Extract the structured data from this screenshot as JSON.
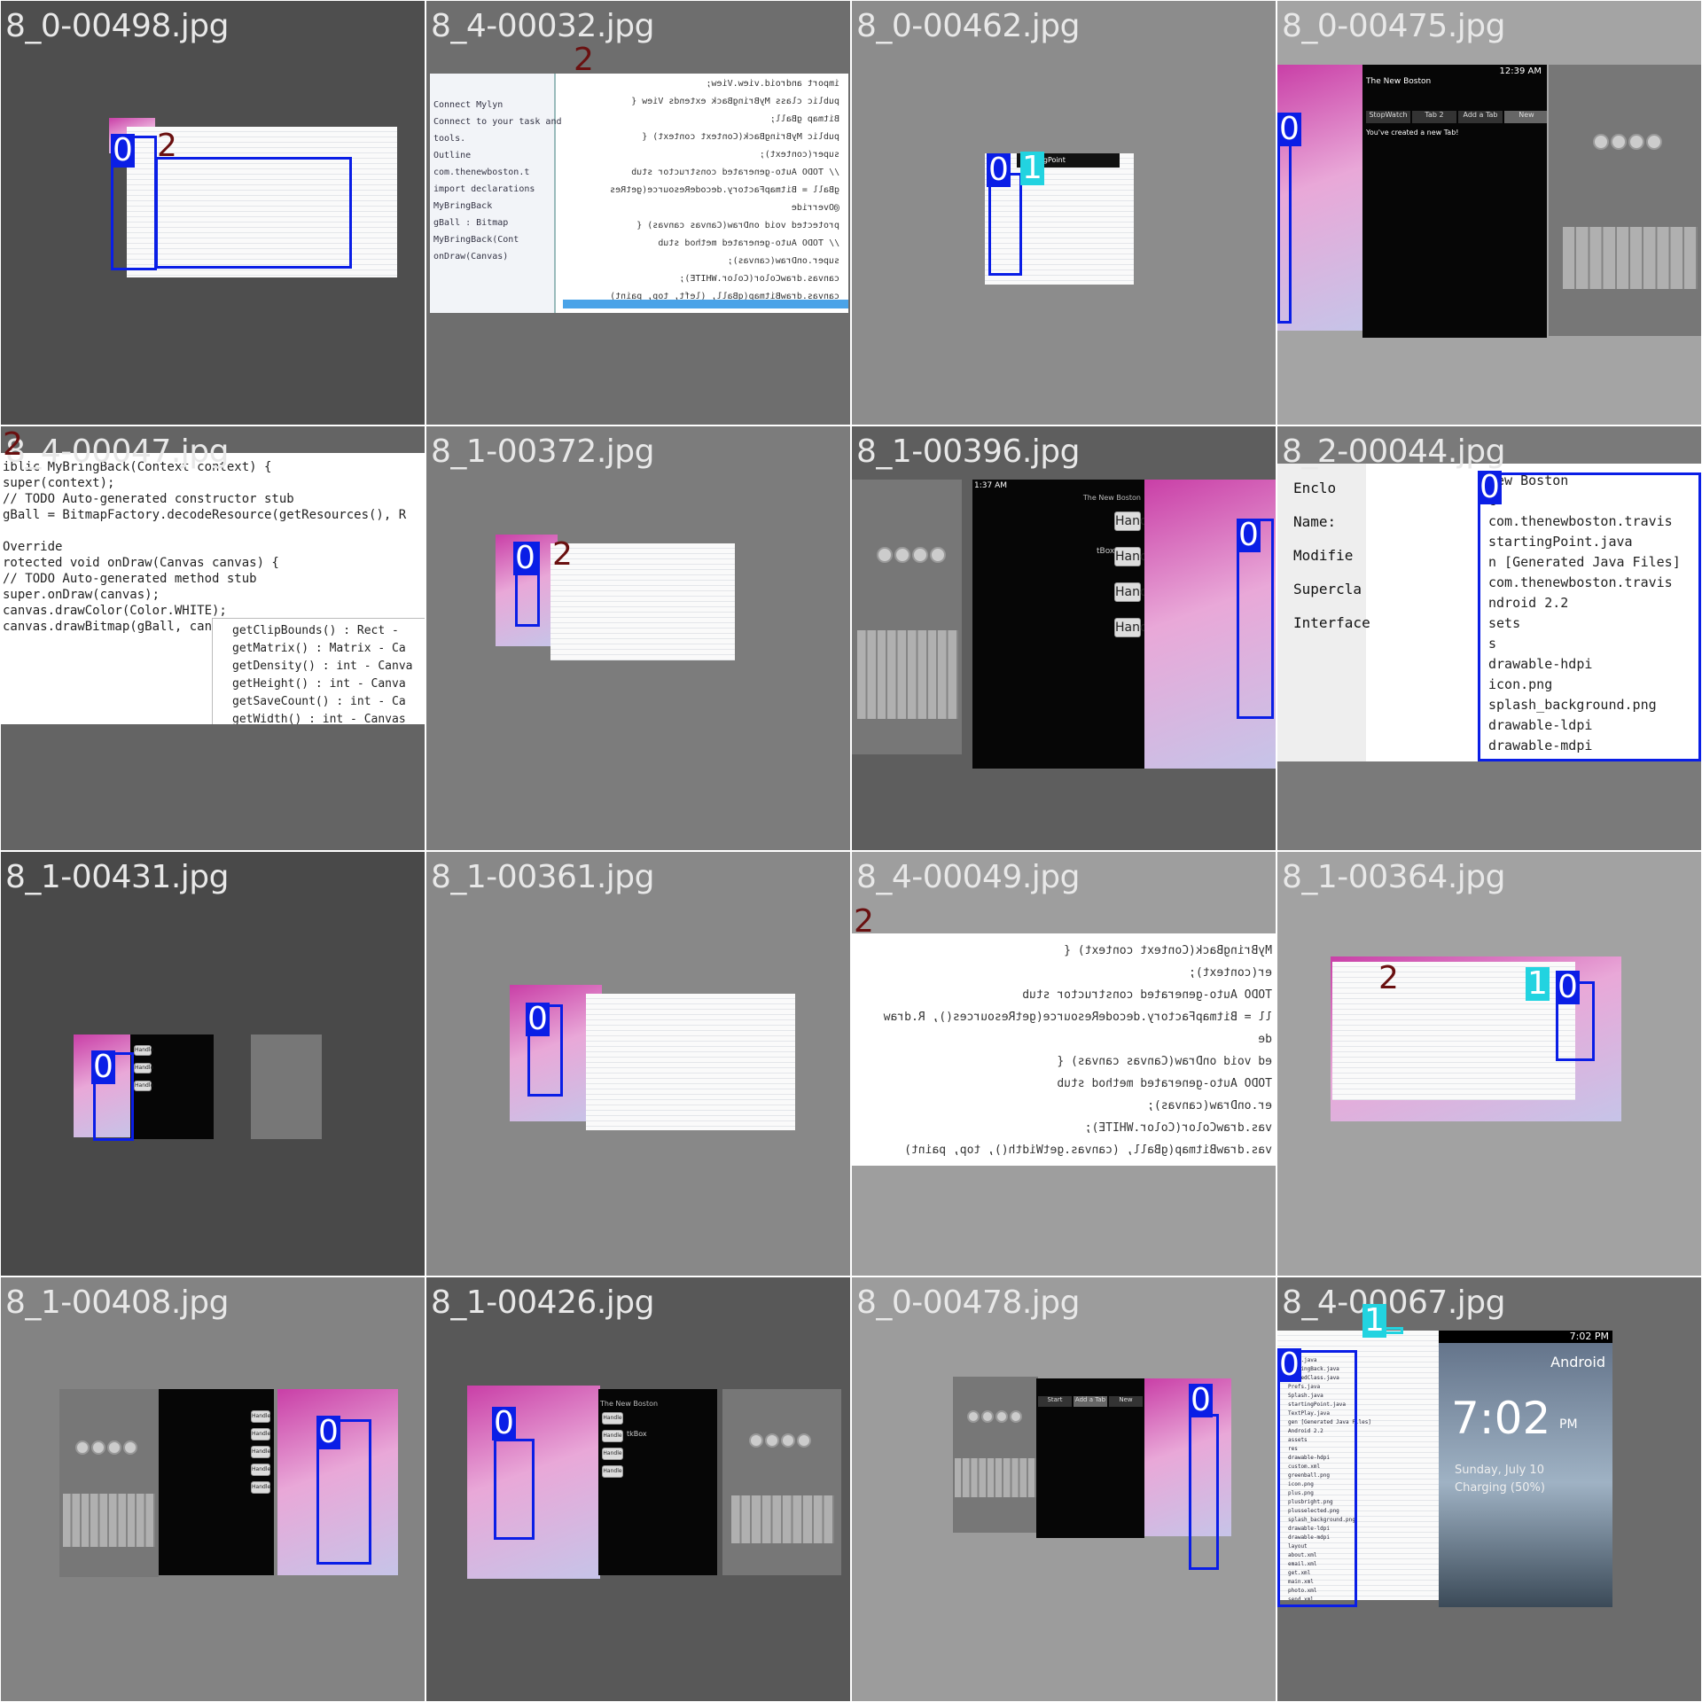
{
  "grid": {
    "cells": [
      {
        "file": "8_0-00498.jpg",
        "bg": "#4e4e4e",
        "labels": [
          {
            "text": "0",
            "cls": "c0"
          },
          {
            "text": "2",
            "cls": "c2"
          }
        ]
      },
      {
        "file": "8_4-00032.jpg",
        "bg": "#6e6e6e",
        "labels": [
          {
            "text": "2",
            "cls": "c2"
          }
        ]
      },
      {
        "file": "8_0-00462.jpg",
        "bg": "#8c8c8c",
        "labels": [
          {
            "text": "0",
            "cls": "c0"
          },
          {
            "text": "1",
            "cls": "c1"
          }
        ]
      },
      {
        "file": "8_0-00475.jpg",
        "bg": "#a4a4a4",
        "labels": [
          {
            "text": "0",
            "cls": "c0"
          }
        ]
      },
      {
        "file": "8_4-00047.jpg",
        "bg": "#646464",
        "labels": [
          {
            "text": "2",
            "cls": "c2"
          }
        ]
      },
      {
        "file": "8_1-00372.jpg",
        "bg": "#7c7c7c",
        "labels": [
          {
            "text": "0",
            "cls": "c0"
          },
          {
            "text": "2",
            "cls": "c2"
          }
        ]
      },
      {
        "file": "8_1-00396.jpg",
        "bg": "#5e5e5e",
        "labels": [
          {
            "text": "0",
            "cls": "c0"
          }
        ]
      },
      {
        "file": "8_2-00044.jpg",
        "bg": "#7a7a7a",
        "labels": [
          {
            "text": "0",
            "cls": "c0"
          }
        ]
      },
      {
        "file": "8_1-00431.jpg",
        "bg": "#494949",
        "labels": [
          {
            "text": "0",
            "cls": "c0"
          }
        ]
      },
      {
        "file": "8_1-00361.jpg",
        "bg": "#888888",
        "labels": [
          {
            "text": "0",
            "cls": "c0"
          }
        ]
      },
      {
        "file": "8_4-00049.jpg",
        "bg": "#9e9e9e",
        "labels": [
          {
            "text": "2",
            "cls": "c2"
          }
        ]
      },
      {
        "file": "8_1-00364.jpg",
        "bg": "#a2a2a2",
        "labels": [
          {
            "text": "2",
            "cls": "c2"
          },
          {
            "text": "1",
            "cls": "c1"
          },
          {
            "text": "0",
            "cls": "c0"
          }
        ]
      },
      {
        "file": "8_1-00408.jpg",
        "bg": "#838383",
        "labels": [
          {
            "text": "0",
            "cls": "c0"
          }
        ]
      },
      {
        "file": "8_1-00426.jpg",
        "bg": "#585858",
        "labels": [
          {
            "text": "0",
            "cls": "c0"
          }
        ]
      },
      {
        "file": "8_0-00478.jpg",
        "bg": "#9c9c9c",
        "labels": [
          {
            "text": "0",
            "cls": "c0"
          }
        ]
      },
      {
        "file": "8_4-00067.jpg",
        "bg": "#6c6c6c",
        "labels": [
          {
            "text": "0",
            "cls": "c0"
          },
          {
            "text": "1",
            "cls": "c1"
          }
        ]
      }
    ]
  },
  "snippets": {
    "c2_lines": [
      "import android.view.View;",
      "public class MyBringBack extends View {",
      "Bitmap gBall;",
      "public MyBringBack(Context context) {",
      "super(context);",
      "// TODO Auto-generated constructor stub",
      "gBall = BitmapFactory.decodeResource(getRes",
      "@Override",
      "protected void onDraw(Canvas canvas) {",
      "// TODO Auto-generated method stub",
      "super.onDraw(canvas);",
      "canvas.drawColor(Color.WHITE);",
      "canvas.drawBitmap(gBall, (left, top, paint)"
    ],
    "c2_outline": [
      "Connect Mylyn",
      "Connect to your task and",
      "tools.",
      "Outline",
      "com.thenewboston.t",
      "import declarations",
      "MyBringBack",
      "gBall : Bitmap",
      "MyBringBack(Cont",
      "onDraw(Canvas)"
    ],
    "c4_lines": [
      "iblic MyBringBack(Context context) {",
      "  super(context);",
      "  // TODO Auto-generated constructor stub",
      "  gBall = BitmapFactory.decodeResource(getResources(), R",
      "",
      "Override",
      "rotected void onDraw(Canvas canvas) {",
      "  // TODO Auto-generated method stub",
      "  super.onDraw(canvas);",
      "  canvas.drawColor(Color.WHITE);",
      "  canvas.drawBitmap(gBall, canvas.  top, paint)"
    ],
    "c4_completions": [
      "getClipBounds() : Rect -",
      "getMatrix() : Matrix - Ca",
      "getDensity() : int - Canva",
      "getHeight() : int - Canva",
      "getSaveCount() : int - Ca",
      "getWidth() : int - Canvas"
    ],
    "c7_lines": [
      "New Boston",
      "c",
      "com.thenewboston.travis",
      "startingPoint.java",
      "n [Generated Java Files]",
      "com.thenewboston.travis",
      "ndroid 2.2",
      "sets",
      "s",
      "drawable-hdpi",
      "icon.png",
      "splash_background.png",
      "drawable-ldpi",
      "drawable-mdpi"
    ],
    "c7_form": [
      "Enclo",
      "Name:",
      "Modifie",
      "Supercla",
      "Interface"
    ],
    "c10_lines": [
      "MyBringBack(Context context) {",
      "er(context);",
      "TODO Auto-generated constructor stub",
      "ll = BitmapFactory.decodeResource(getResources(), R.draw",
      "de",
      "ed void onDraw(Canvas canvas) {",
      "TODO Auto-generated method stub",
      "er.onDraw(canvas);",
      "vas.drawColor(Color.WHITE);",
      "vas.drawBitmap(gBall, (canvas.getWidth(), top, paint)"
    ],
    "c3_status": "12:39 AM",
    "c3_app": "The New Boston",
    "c3_tabs": [
      "StopWatch",
      "Tab 2",
      "Add a Tab",
      "New"
    ],
    "c3_msg": "You've created a new Tab!",
    "c15_status": "7:02 PM",
    "c15_carrier": "Android",
    "c15_time": "7:02",
    "c15_ampm": "PM",
    "c15_date": "Sunday, July 10",
    "c15_charge": "Charging (50%)",
    "c15_tree": [
      "Menu.java",
      "MyBringBack.java",
      "OpenedClass.java",
      "Prefs.java",
      "Splash.java",
      "startingPoint.java",
      "TextPlay.java",
      "gen [Generated Java Files]",
      "Android 2.2",
      "assets",
      "res",
      "drawable-hdpi",
      "custom.xml",
      "greenball.png",
      "icon.png",
      "plus.png",
      "plusbright.png",
      "plusselected.png",
      "splash_background.png",
      "drawable-ldpi",
      "drawable-mdpi",
      "layout",
      "about.xml",
      "email.xml",
      "get.xml",
      "main.xml",
      "photo.xml",
      "send.xml"
    ],
    "c6_status": "1:37 AM",
    "c6_title": "The New Boston",
    "c6_buttons": [
      "Handle",
      "Handle",
      "Handle",
      "Handle"
    ],
    "c6_box": "tBox",
    "c8_buttons": [
      "Handle",
      "Handle",
      "Handle"
    ],
    "c12_buttons": [
      "Handle",
      "Handle",
      "Handle",
      "Handle",
      "Handle"
    ],
    "c13_title": "The New Boston",
    "c13_buttons": [
      "Handle",
      "Handle",
      "Handle",
      "Handle"
    ],
    "c13_box": "tkBox",
    "c14_tabs": [
      "Start",
      "Add a Tab",
      "New"
    ],
    "c2_top_label": "startingPoint"
  }
}
